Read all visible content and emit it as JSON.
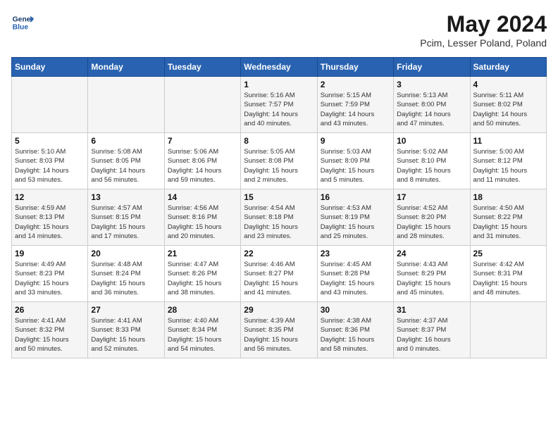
{
  "header": {
    "logo_line1": "General",
    "logo_line2": "Blue",
    "month": "May 2024",
    "location": "Pcim, Lesser Poland, Poland"
  },
  "weekdays": [
    "Sunday",
    "Monday",
    "Tuesday",
    "Wednesday",
    "Thursday",
    "Friday",
    "Saturday"
  ],
  "weeks": [
    [
      {
        "day": "",
        "info": ""
      },
      {
        "day": "",
        "info": ""
      },
      {
        "day": "",
        "info": ""
      },
      {
        "day": "1",
        "info": "Sunrise: 5:16 AM\nSunset: 7:57 PM\nDaylight: 14 hours\nand 40 minutes."
      },
      {
        "day": "2",
        "info": "Sunrise: 5:15 AM\nSunset: 7:59 PM\nDaylight: 14 hours\nand 43 minutes."
      },
      {
        "day": "3",
        "info": "Sunrise: 5:13 AM\nSunset: 8:00 PM\nDaylight: 14 hours\nand 47 minutes."
      },
      {
        "day": "4",
        "info": "Sunrise: 5:11 AM\nSunset: 8:02 PM\nDaylight: 14 hours\nand 50 minutes."
      }
    ],
    [
      {
        "day": "5",
        "info": "Sunrise: 5:10 AM\nSunset: 8:03 PM\nDaylight: 14 hours\nand 53 minutes."
      },
      {
        "day": "6",
        "info": "Sunrise: 5:08 AM\nSunset: 8:05 PM\nDaylight: 14 hours\nand 56 minutes."
      },
      {
        "day": "7",
        "info": "Sunrise: 5:06 AM\nSunset: 8:06 PM\nDaylight: 14 hours\nand 59 minutes."
      },
      {
        "day": "8",
        "info": "Sunrise: 5:05 AM\nSunset: 8:08 PM\nDaylight: 15 hours\nand 2 minutes."
      },
      {
        "day": "9",
        "info": "Sunrise: 5:03 AM\nSunset: 8:09 PM\nDaylight: 15 hours\nand 5 minutes."
      },
      {
        "day": "10",
        "info": "Sunrise: 5:02 AM\nSunset: 8:10 PM\nDaylight: 15 hours\nand 8 minutes."
      },
      {
        "day": "11",
        "info": "Sunrise: 5:00 AM\nSunset: 8:12 PM\nDaylight: 15 hours\nand 11 minutes."
      }
    ],
    [
      {
        "day": "12",
        "info": "Sunrise: 4:59 AM\nSunset: 8:13 PM\nDaylight: 15 hours\nand 14 minutes."
      },
      {
        "day": "13",
        "info": "Sunrise: 4:57 AM\nSunset: 8:15 PM\nDaylight: 15 hours\nand 17 minutes."
      },
      {
        "day": "14",
        "info": "Sunrise: 4:56 AM\nSunset: 8:16 PM\nDaylight: 15 hours\nand 20 minutes."
      },
      {
        "day": "15",
        "info": "Sunrise: 4:54 AM\nSunset: 8:18 PM\nDaylight: 15 hours\nand 23 minutes."
      },
      {
        "day": "16",
        "info": "Sunrise: 4:53 AM\nSunset: 8:19 PM\nDaylight: 15 hours\nand 25 minutes."
      },
      {
        "day": "17",
        "info": "Sunrise: 4:52 AM\nSunset: 8:20 PM\nDaylight: 15 hours\nand 28 minutes."
      },
      {
        "day": "18",
        "info": "Sunrise: 4:50 AM\nSunset: 8:22 PM\nDaylight: 15 hours\nand 31 minutes."
      }
    ],
    [
      {
        "day": "19",
        "info": "Sunrise: 4:49 AM\nSunset: 8:23 PM\nDaylight: 15 hours\nand 33 minutes."
      },
      {
        "day": "20",
        "info": "Sunrise: 4:48 AM\nSunset: 8:24 PM\nDaylight: 15 hours\nand 36 minutes."
      },
      {
        "day": "21",
        "info": "Sunrise: 4:47 AM\nSunset: 8:26 PM\nDaylight: 15 hours\nand 38 minutes."
      },
      {
        "day": "22",
        "info": "Sunrise: 4:46 AM\nSunset: 8:27 PM\nDaylight: 15 hours\nand 41 minutes."
      },
      {
        "day": "23",
        "info": "Sunrise: 4:45 AM\nSunset: 8:28 PM\nDaylight: 15 hours\nand 43 minutes."
      },
      {
        "day": "24",
        "info": "Sunrise: 4:43 AM\nSunset: 8:29 PM\nDaylight: 15 hours\nand 45 minutes."
      },
      {
        "day": "25",
        "info": "Sunrise: 4:42 AM\nSunset: 8:31 PM\nDaylight: 15 hours\nand 48 minutes."
      }
    ],
    [
      {
        "day": "26",
        "info": "Sunrise: 4:41 AM\nSunset: 8:32 PM\nDaylight: 15 hours\nand 50 minutes."
      },
      {
        "day": "27",
        "info": "Sunrise: 4:41 AM\nSunset: 8:33 PM\nDaylight: 15 hours\nand 52 minutes."
      },
      {
        "day": "28",
        "info": "Sunrise: 4:40 AM\nSunset: 8:34 PM\nDaylight: 15 hours\nand 54 minutes."
      },
      {
        "day": "29",
        "info": "Sunrise: 4:39 AM\nSunset: 8:35 PM\nDaylight: 15 hours\nand 56 minutes."
      },
      {
        "day": "30",
        "info": "Sunrise: 4:38 AM\nSunset: 8:36 PM\nDaylight: 15 hours\nand 58 minutes."
      },
      {
        "day": "31",
        "info": "Sunrise: 4:37 AM\nSunset: 8:37 PM\nDaylight: 16 hours\nand 0 minutes."
      },
      {
        "day": "",
        "info": ""
      }
    ]
  ]
}
